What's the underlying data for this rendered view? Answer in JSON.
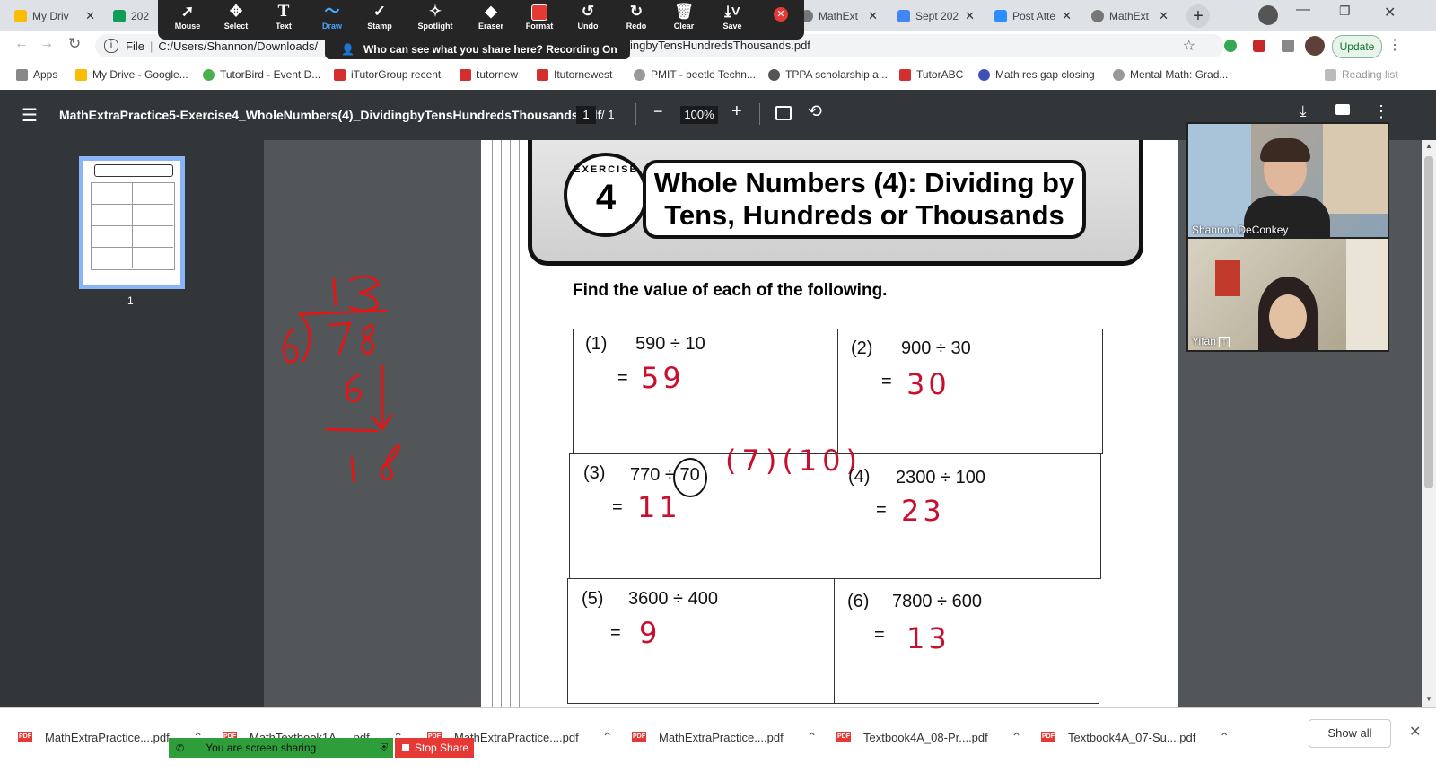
{
  "browser": {
    "tabs": [
      {
        "label": "My Driv",
        "color": "#fbbc04"
      },
      {
        "label": "202",
        "color": "#0f9d58"
      },
      {
        "label": "MathExt",
        "color": "#777777"
      },
      {
        "label": "Sept 202",
        "color": "#4285f4"
      },
      {
        "label": "Post Atte",
        "color": "#2d8cff"
      },
      {
        "label": "MathExt",
        "color": "#777777"
      }
    ],
    "new_tab": "+",
    "address_prefix": "File",
    "address_left": "C:/Users/Shannon/Downloads/",
    "address_right": "ingbyTensHundredsThousands.pdf",
    "update_label": "Update",
    "bookmarks": [
      {
        "label": "Apps",
        "color": "#888888"
      },
      {
        "label": "My Drive - Google...",
        "color": "#fbbc04"
      },
      {
        "label": "TutorBird - Event D...",
        "color": "#4caf50"
      },
      {
        "label": "iTutorGroup recent",
        "color": "#d32f2f"
      },
      {
        "label": "tutornew",
        "color": "#d32f2f"
      },
      {
        "label": "Itutornewest",
        "color": "#d32f2f"
      },
      {
        "label": "PMIT - beetle Techn...",
        "color": "#999999"
      },
      {
        "label": "TPPA scholarship a...",
        "color": "#555555"
      },
      {
        "label": "TutorABC",
        "color": "#d32f2f"
      },
      {
        "label": "Math res gap closing",
        "color": "#3f51b5"
      },
      {
        "label": "Mental Math: Grad...",
        "color": "#999999"
      }
    ],
    "reading_list": "Reading list"
  },
  "zoom_toolbar": {
    "tools": [
      "Mouse",
      "Select",
      "Text",
      "Draw",
      "Stamp",
      "Spotlight",
      "Eraser",
      "Format",
      "Undo",
      "Redo",
      "Clear",
      "Save"
    ],
    "share_notice": "Who can see what you share here? Recording On"
  },
  "pdf_viewer": {
    "filename": "MathExtraPractice5-Exercise4_WholeNumbers(4)_DividingbyTensHundredsThousands.pdf",
    "page_current": "1",
    "page_total": "/ 1",
    "zoom": "100%",
    "thumbnail_page": "1"
  },
  "worksheet": {
    "exercise_word": "EXERCISE",
    "exercise_number": "4",
    "title_line1": "Whole Numbers (4): Dividing by",
    "title_line2": "Tens, Hundreds or Thousands",
    "instruction": "Find the value of each of the following.",
    "problems": [
      {
        "num": "(1)",
        "expr": "590 ÷ 10",
        "eq": "=",
        "answer": "59"
      },
      {
        "num": "(2)",
        "expr": "900 ÷ 30",
        "eq": "=",
        "answer": "30"
      },
      {
        "num": "(3)",
        "expr": "770 ÷ 70",
        "eq": "=",
        "answer": "11"
      },
      {
        "num": "(4)",
        "expr": "2300 ÷ 100",
        "eq": "=",
        "answer": "23"
      },
      {
        "num": "(5)",
        "expr": "3600 ÷ 400",
        "eq": "=",
        "answer": "9"
      },
      {
        "num": "(6)",
        "expr": "7800 ÷ 600",
        "eq": "=",
        "answer": "13"
      }
    ],
    "annotation_factor": "(7)(10)"
  },
  "scratch": {
    "quotient": "13",
    "divisor": "6",
    "dividend": "78",
    "sub": "6",
    "remainder_line": "18"
  },
  "participants": [
    {
      "name": "Shannon DeConkey"
    },
    {
      "name": "Yifan"
    }
  ],
  "downloads": {
    "items": [
      "MathExtraPractice....pdf",
      "MathTextbook1A-....pdf",
      "MathExtraPractice....pdf",
      "MathExtraPractice....pdf",
      "Textbook4A_08-Pr....pdf",
      "Textbook4A_07-Su....pdf"
    ],
    "show_all": "Show all"
  },
  "zoom_share": {
    "status": "You are screen sharing",
    "stop": "Stop Share"
  },
  "colors": {
    "ink": "#c8102e",
    "accent": "#1a73e8"
  }
}
